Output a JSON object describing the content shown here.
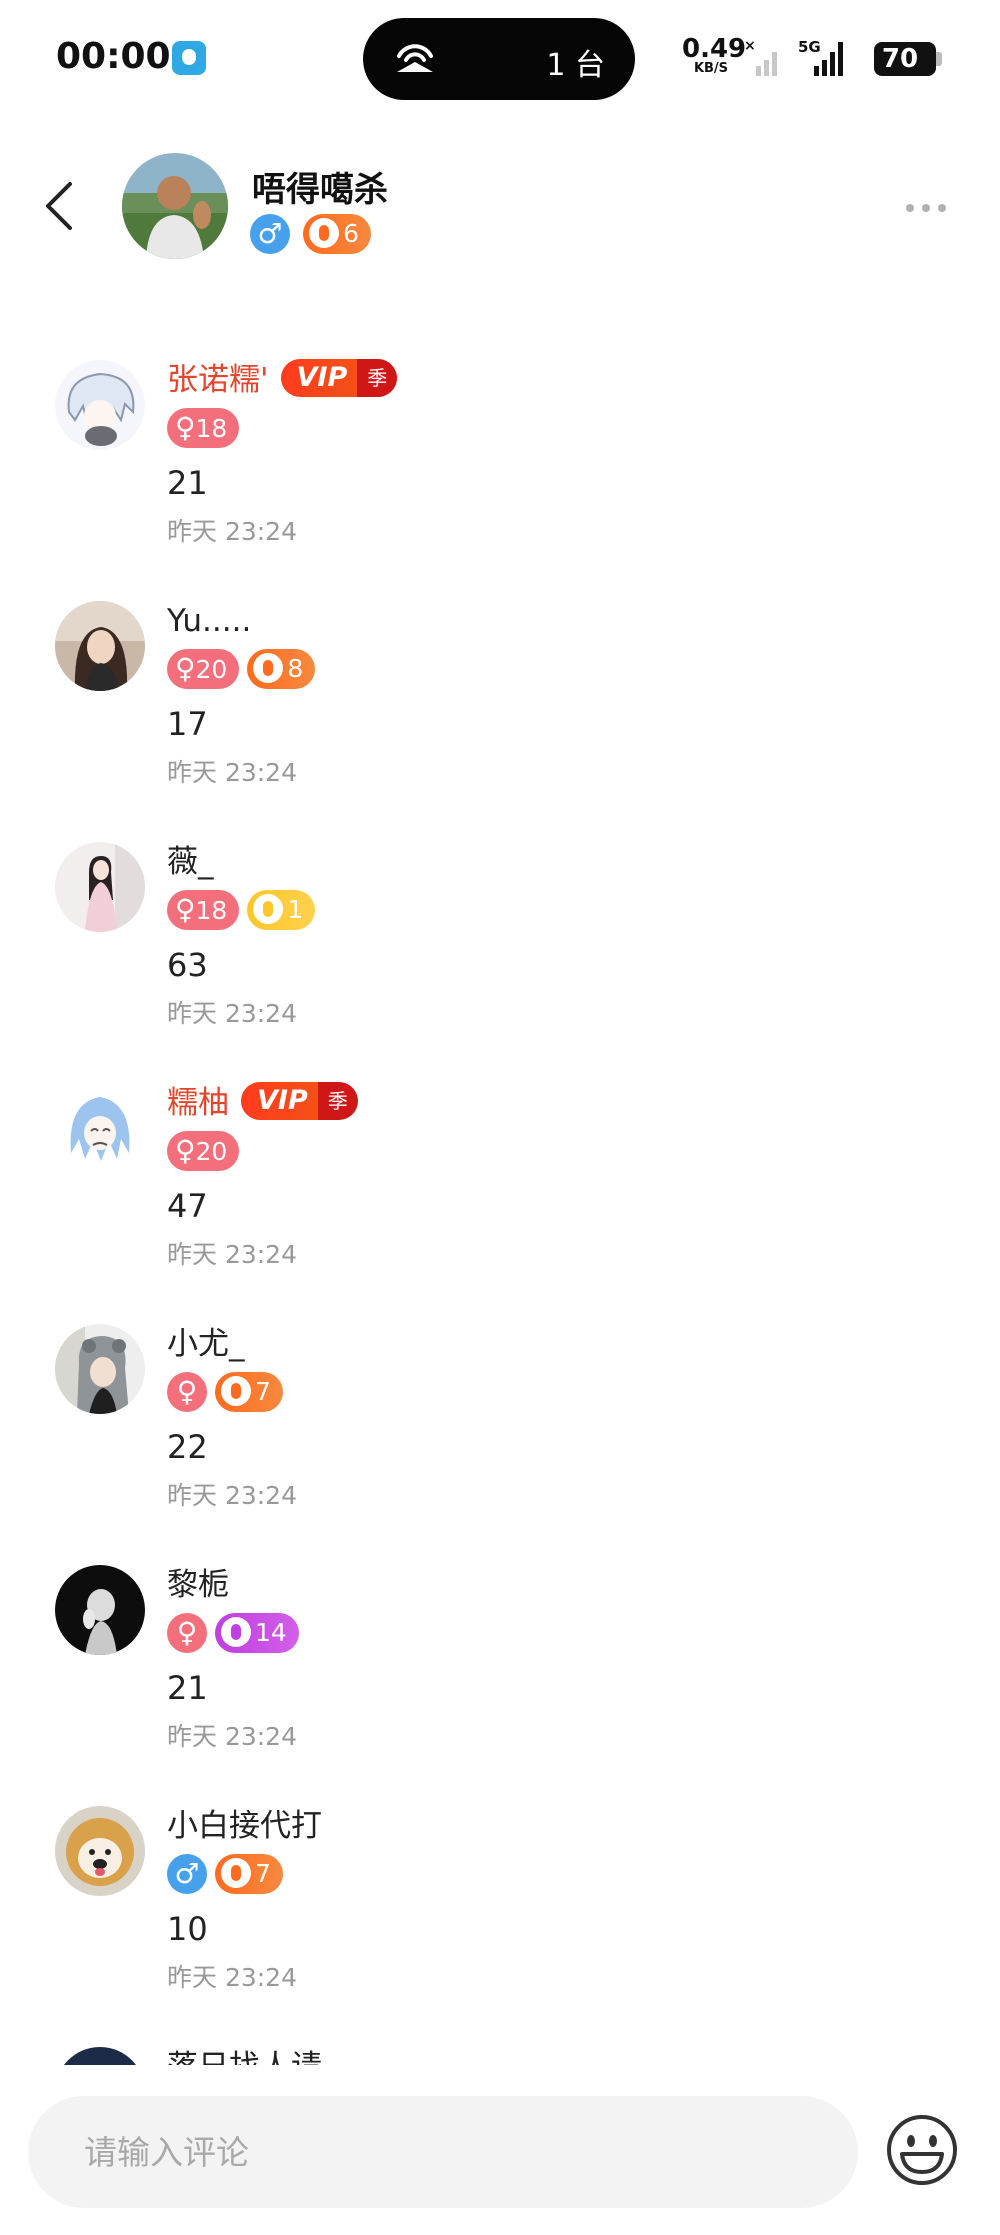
{
  "status_bar": {
    "time": "00:00",
    "island_text": "1 台",
    "net_speed": "0.49",
    "net_unit": "KB/S",
    "network": "5G",
    "battery": "70"
  },
  "header": {
    "title": "唔得噶杀",
    "gender": "male",
    "level": "6"
  },
  "comments": [
    {
      "name": "张诺糯'",
      "vip": true,
      "vip_label": "VIP",
      "vip_season": "季",
      "gender_age": "18",
      "level": null,
      "text": "21",
      "time": "昨天 23:24"
    },
    {
      "name": "Yu.....",
      "vip": false,
      "gender_age": "20",
      "level": "8",
      "text": "17",
      "time": "昨天 23:24"
    },
    {
      "name": "薇_",
      "vip": false,
      "gender_age": "18",
      "level": "1",
      "text": "63",
      "time": "昨天 23:24"
    },
    {
      "name": "糯柚",
      "vip": true,
      "vip_label": "VIP",
      "vip_season": "季",
      "gender_age": "20",
      "level": null,
      "text": "47",
      "time": "昨天 23:24"
    },
    {
      "name": "小尤_",
      "vip": false,
      "gender_age": "",
      "level": "7",
      "text": "22",
      "time": "昨天 23:24"
    },
    {
      "name": "黎栀",
      "vip": false,
      "gender_age": "",
      "level": "14",
      "text": "21",
      "time": "昨天 23:24"
    },
    {
      "name": "小白接代打",
      "vip": false,
      "gender_age": "",
      "gender": "male",
      "level": "7",
      "text": "10",
      "time": "昨天 23:24"
    },
    {
      "name": "落日找人请",
      "partial": true
    }
  ],
  "input": {
    "placeholder": "请输入评论"
  },
  "colors": {
    "female": "#f36f7c",
    "male": "#46a0ec",
    "vip_name": "#e2462c",
    "level_orange": "#ff6a1e",
    "level_yellow": "#ffc62a",
    "level_purple": "#c13ee0"
  },
  "icons": [
    "back-arrow-icon",
    "more-dots-icon",
    "emoji-icon",
    "wifi-icon",
    "signal-icon",
    "battery-icon",
    "gem-icon"
  ]
}
